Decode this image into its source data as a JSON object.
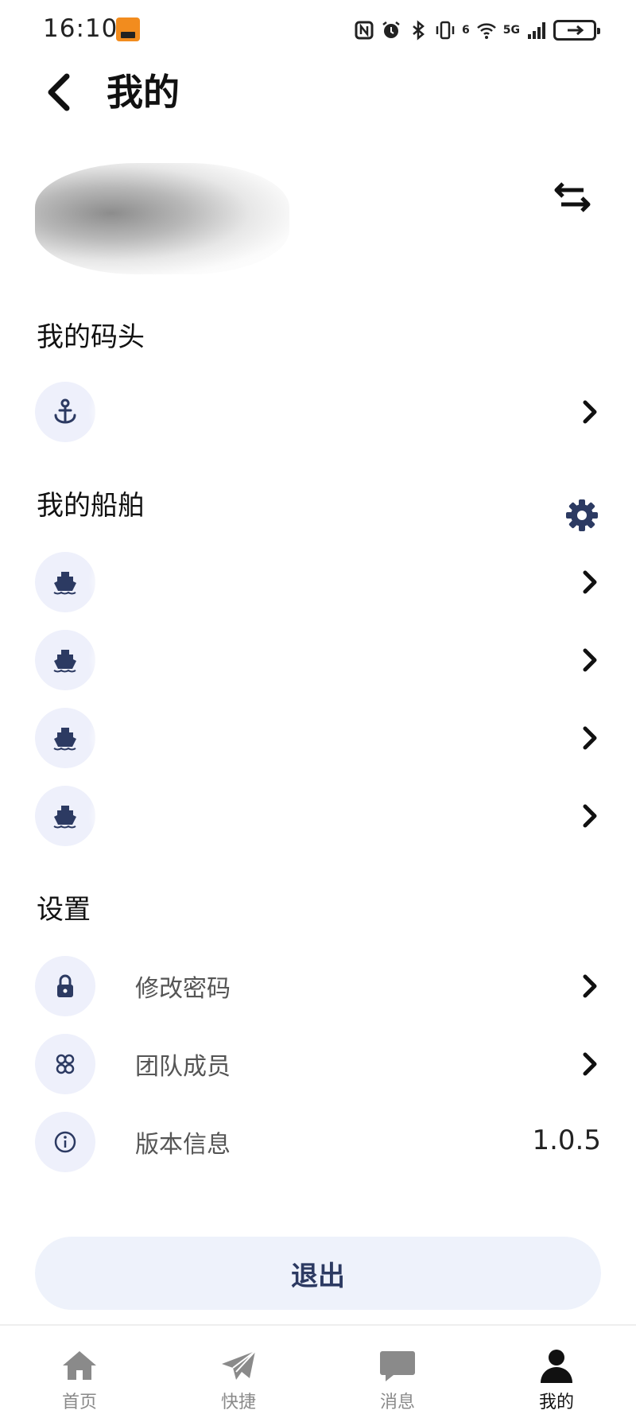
{
  "status_bar": {
    "time": "16:10",
    "network": "5G",
    "wifi_badge": "6"
  },
  "header": {
    "title": "我的"
  },
  "sections": {
    "dock_title": "我的码头",
    "ships_title": "我的船舶",
    "settings_title": "设置"
  },
  "dock": {
    "items": [
      {
        "icon": "anchor-icon"
      }
    ]
  },
  "ships": {
    "items": [
      {
        "icon": "ship-icon"
      },
      {
        "icon": "ship-icon"
      },
      {
        "icon": "ship-icon"
      },
      {
        "icon": "ship-icon"
      }
    ]
  },
  "settings": {
    "change_password": "修改密码",
    "team_members": "团队成员",
    "version_info": "版本信息",
    "version_value": "1.0.5"
  },
  "logout_label": "退出",
  "nav": {
    "items": [
      {
        "label": "首页",
        "icon": "home-icon"
      },
      {
        "label": "快捷",
        "icon": "paper-plane-icon"
      },
      {
        "label": "消息",
        "icon": "message-icon"
      },
      {
        "label": "我的",
        "icon": "person-icon"
      }
    ],
    "active": "我的"
  },
  "colors": {
    "accent": "#2c3a62",
    "icon_bg": "#eef0fb",
    "logout_bg": "#eef2fb"
  }
}
